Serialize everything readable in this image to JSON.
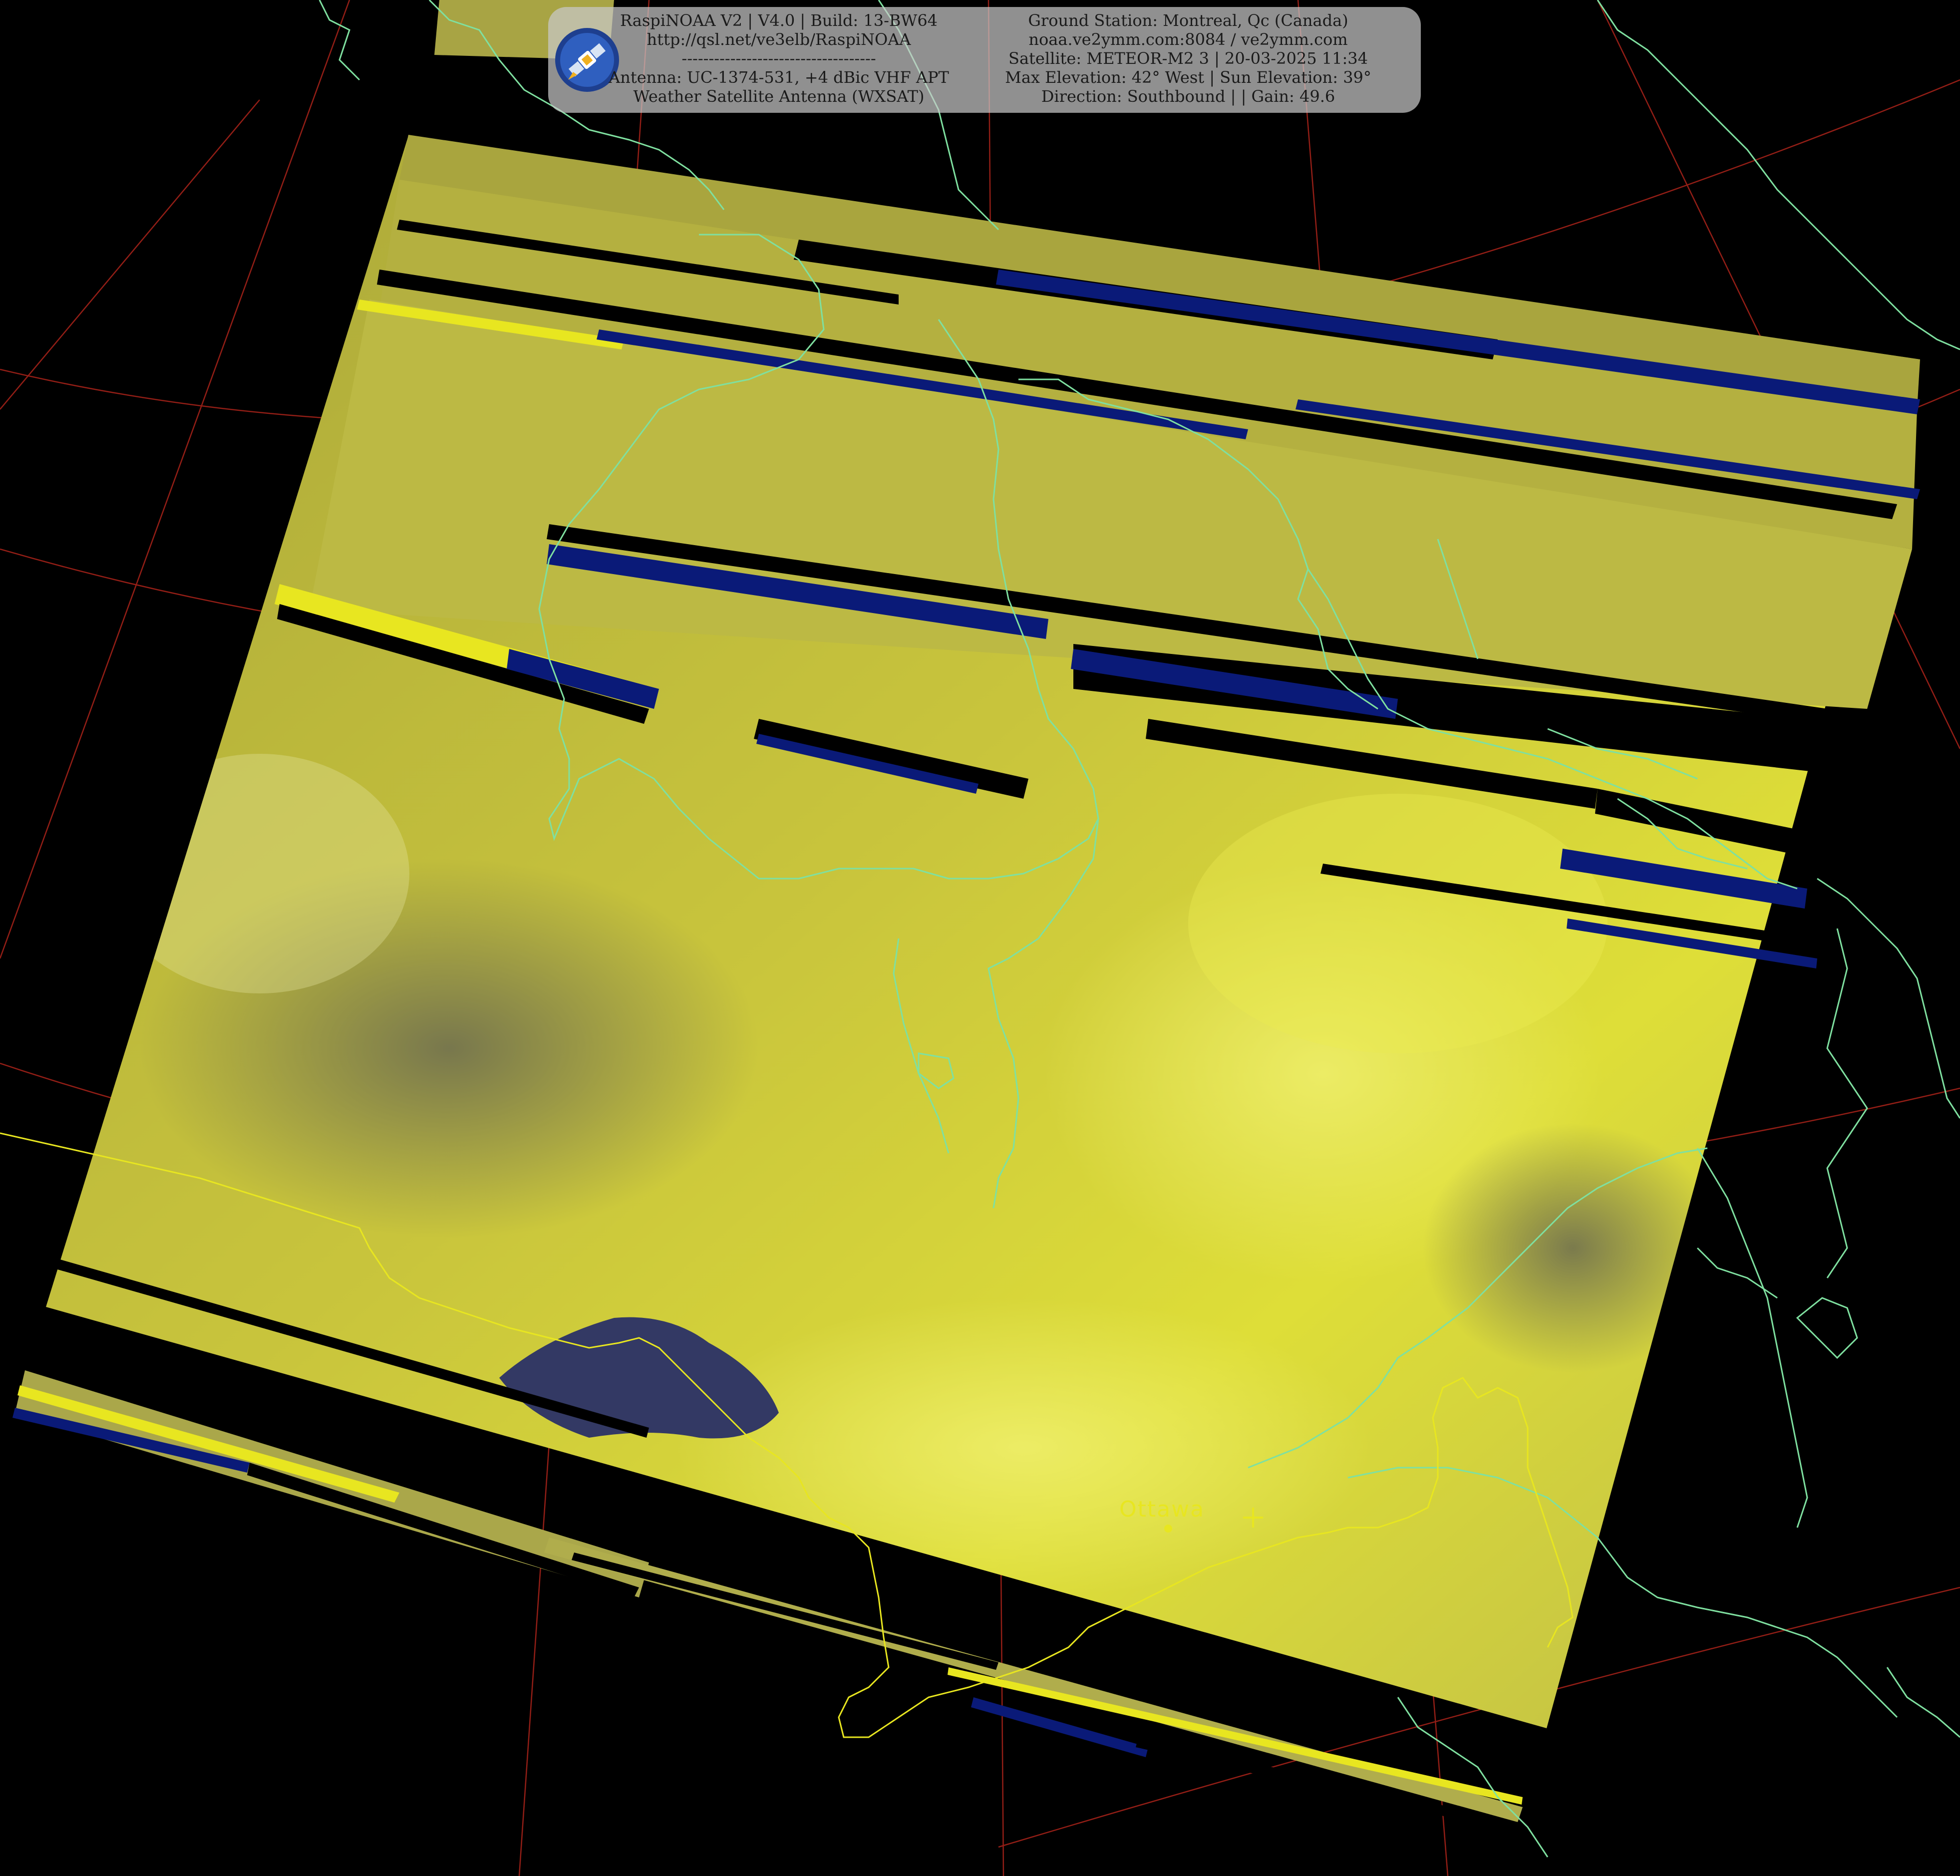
{
  "header": {
    "left_lines": [
      "RaspiNOAA V2 | V4.0 | Build: 13-BW64",
      "http://qsl.net/ve3elb/RaspiNOAA",
      "------------------------------------",
      "Antenna: UC-1374-531, +4 dBic VHF APT",
      "Weather Satellite Antenna (WXSAT)"
    ],
    "right_lines": [
      "Ground Station: Montreal, Qc (Canada)",
      "noaa.ve2ymm.com:8084 / ve2ymm.com",
      "Satellite: METEOR-M2 3 | 20-03-2025 11:34",
      "Max Elevation: 42° West | Sun Elevation: 39°",
      "Direction: Southbound | | Gain: 49.6"
    ],
    "logo_icon": "satellite-logo-icon"
  },
  "map": {
    "city_label": "Ottawa",
    "station_marker_icon": "plus-marker-icon",
    "colors": {
      "background": "#000000",
      "image_yellow": "#c9c63a",
      "coastline": "#7fe0a0",
      "border": "#e8e620",
      "graticule": "#c8281e",
      "dropout_blue": "#0a1a78"
    }
  }
}
